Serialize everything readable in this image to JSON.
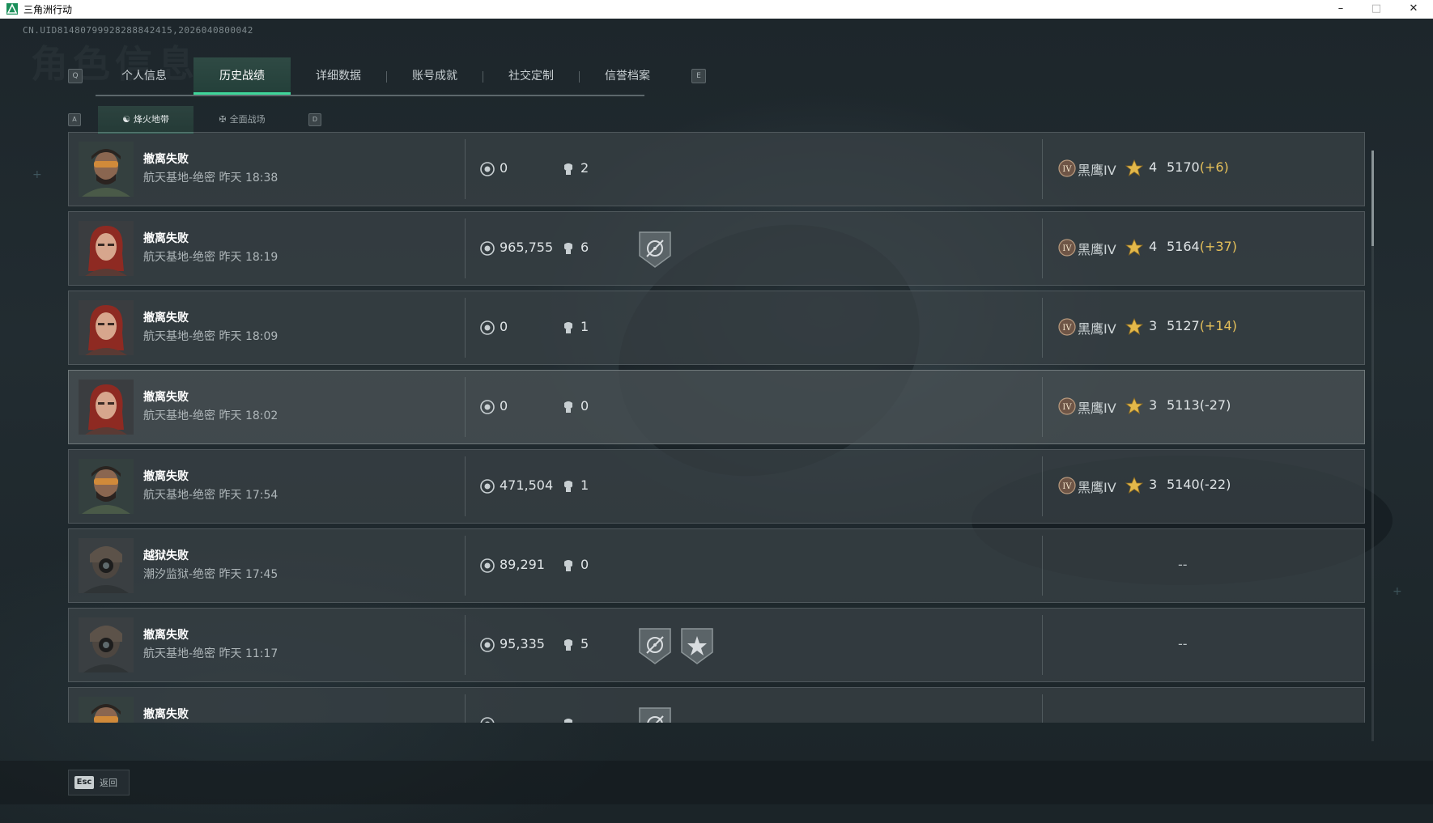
{
  "window": {
    "title": "三角洲行动"
  },
  "header": {
    "uid": "CN.UID8148079992828884241​5,2026040800042",
    "watermark": "角色信息"
  },
  "tabs": {
    "left_key": "Q",
    "right_key": "E",
    "items": [
      {
        "label": "个人信息",
        "active": false
      },
      {
        "label": "历史战绩",
        "active": true
      },
      {
        "label": "详细数据",
        "active": false
      },
      {
        "label": "账号成就",
        "active": false
      },
      {
        "label": "社交定制",
        "active": false
      },
      {
        "label": "信誉档案",
        "active": false
      }
    ]
  },
  "subtabs": {
    "left_key": "A",
    "right_key": "D",
    "items": [
      {
        "label": "烽火地带",
        "active": true
      },
      {
        "label": "全面战场",
        "active": false
      }
    ]
  },
  "records": [
    {
      "avatar": "male-goggles",
      "title": "撤离失败",
      "subtitle": "航天基地-绝密 昨天 18:38",
      "coins": "0",
      "kills": "2",
      "badges": [],
      "rank": "黑鹰IV",
      "stars": "4",
      "score": "5170",
      "delta": "(+6)",
      "delta_positive": true
    },
    {
      "avatar": "female-red",
      "title": "撤离失败",
      "subtitle": "航天基地-绝密 昨天 18:19",
      "coins": "965,755",
      "kills": "6",
      "badges": [
        "crosshair-badge"
      ],
      "rank": "黑鹰IV",
      "stars": "4",
      "score": "5164",
      "delta": "(+37)",
      "delta_positive": true
    },
    {
      "avatar": "female-red",
      "title": "撤离失败",
      "subtitle": "航天基地-绝密 昨天 18:09",
      "coins": "0",
      "kills": "1",
      "badges": [],
      "rank": "黑鹰IV",
      "stars": "3",
      "score": "5127",
      "delta": "(+14)",
      "delta_positive": true
    },
    {
      "avatar": "female-red",
      "title": "撤离失败",
      "subtitle": "航天基地-绝密 昨天 18:02",
      "coins": "0",
      "kills": "0",
      "badges": [],
      "rank": "黑鹰IV",
      "stars": "3",
      "score": "5113",
      "delta": "(-27)",
      "delta_positive": false
    },
    {
      "avatar": "male-goggles",
      "title": "撤离失败",
      "subtitle": "航天基地-绝密 昨天 17:54",
      "coins": "471,504",
      "kills": "1",
      "badges": [],
      "rank": "黑鹰IV",
      "stars": "3",
      "score": "5140",
      "delta": "(-22)",
      "delta_positive": false
    },
    {
      "avatar": "masked",
      "title": "越狱失败",
      "subtitle": "潮汐监狱-绝密 昨天 17:45",
      "coins": "89,291",
      "kills": "0",
      "badges": [],
      "no_rank": "--"
    },
    {
      "avatar": "masked",
      "title": "撤离失败",
      "subtitle": "航天基地-绝密 昨天 11:17",
      "coins": "95,335",
      "kills": "5",
      "badges": [
        "crosshair-badge",
        "star-badge"
      ],
      "no_rank": "--"
    },
    {
      "avatar": "male-goggles",
      "title": "撤离失败",
      "subtitle": "",
      "coins": "",
      "kills": "",
      "badges": [
        "crosshair-badge"
      ],
      "partial": true
    }
  ],
  "footer": {
    "esc_key": "Esc",
    "back_label": "返回"
  },
  "colors": {
    "accent": "#3fd69a",
    "gain": "#e6c15a"
  }
}
